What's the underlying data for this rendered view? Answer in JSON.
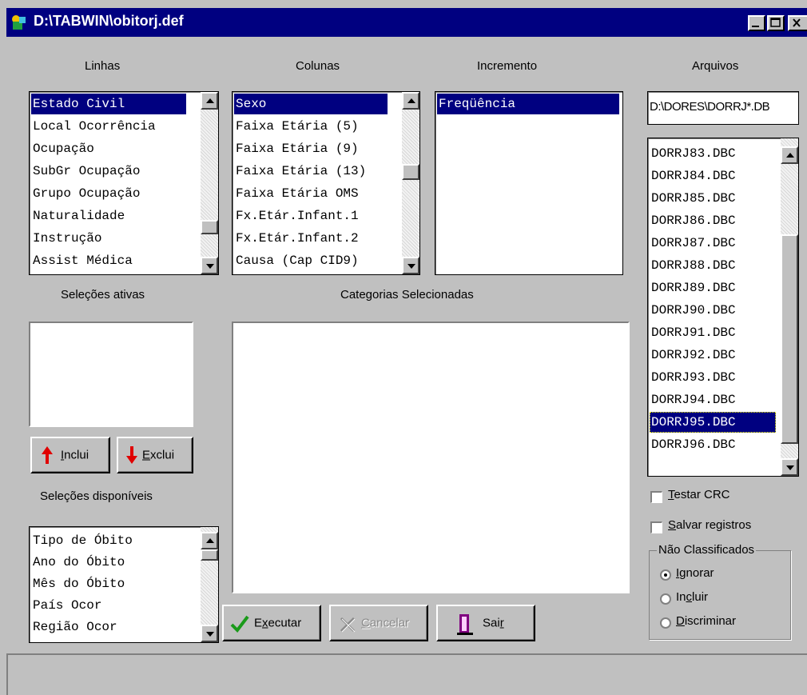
{
  "window": {
    "title": "D:\\TABWIN\\obitorj.def",
    "icon": "tabwin-app-icon"
  },
  "headers": {
    "linhas": "Linhas",
    "colunas": "Colunas",
    "incremento": "Incremento",
    "arquivos": "Arquivos",
    "selecoes_ativas": "Seleções ativas",
    "categorias": "Categorias Selecionadas",
    "selecoes_disponiveis": "Seleções disponíveis"
  },
  "linhas": {
    "items": [
      "Estado Civil",
      "Local Ocorrência",
      "Ocupação",
      "SubGr Ocupação",
      "Grupo Ocupação",
      "Naturalidade",
      "Instrução",
      "Assist Médica"
    ],
    "selected": "Estado Civil"
  },
  "colunas": {
    "items": [
      "Sexo",
      "Faixa Etária (5)",
      "Faixa Etária (9)",
      "Faixa Etária (13)",
      "Faixa Etária OMS",
      "Fx.Etár.Infant.1",
      "Fx.Etár.Infant.2",
      "Causa (Cap CID9)"
    ],
    "selected": "Sexo"
  },
  "incremento": {
    "items": [
      "Freqüência"
    ],
    "selected": "Freqüência"
  },
  "arquivos": {
    "path": "D:\\DORES\\DORRJ*.DB",
    "items": [
      "DORRJ83.DBC",
      "DORRJ84.DBC",
      "DORRJ85.DBC",
      "DORRJ86.DBC",
      "DORRJ87.DBC",
      "DORRJ88.DBC",
      "DORRJ89.DBC",
      "DORRJ90.DBC",
      "DORRJ91.DBC",
      "DORRJ92.DBC",
      "DORRJ93.DBC",
      "DORRJ94.DBC",
      "DORRJ95.DBC",
      "DORRJ96.DBC"
    ],
    "selected": "DORRJ95.DBC"
  },
  "disponiveis": {
    "items": [
      "Tipo de Óbito",
      "Ano do Óbito",
      "Mês do Óbito",
      "País Ocor",
      "Região Ocor"
    ]
  },
  "buttons": {
    "inclui": {
      "pre": "",
      "key": "I",
      "post": "nclui"
    },
    "exclui": {
      "pre": "",
      "key": "E",
      "post": "xclui"
    },
    "executar": {
      "pre": "E",
      "key": "x",
      "post": "ecutar"
    },
    "cancelar": {
      "pre": "",
      "key": "C",
      "post": "ancelar"
    },
    "sair": {
      "pre": "Sai",
      "key": "r",
      "post": ""
    }
  },
  "options": {
    "testar_crc": {
      "pre": "",
      "key": "T",
      "post": "estar CRC",
      "checked": false
    },
    "salvar_registros": {
      "pre": "",
      "key": "S",
      "post": "alvar registros",
      "checked": false
    }
  },
  "nao_classificados": {
    "legend": "Não Classificados",
    "ignorar": {
      "pre": "",
      "key": "I",
      "post": "gnorar",
      "selected": true
    },
    "incluir": {
      "pre": "In",
      "key": "c",
      "post": "luir",
      "selected": false
    },
    "discriminar": {
      "pre": "",
      "key": "D",
      "post": "iscriminar",
      "selected": false
    }
  },
  "colors": {
    "titlebar": "#000080",
    "face": "#c0c0c0",
    "selection": "#000080",
    "check_green": "#1a9a1a",
    "arrow_red": "#e00000"
  }
}
